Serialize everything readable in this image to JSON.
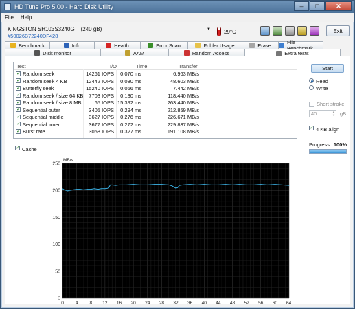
{
  "window": {
    "title": "HD Tune Pro 5.00 - Hard Disk Utility",
    "minimize": "–",
    "maximize": "□",
    "close": "✕"
  },
  "menu": {
    "file": "File",
    "help": "Help"
  },
  "device": {
    "name": "KINGSTON SH103S3240G",
    "capacity": "(240 gB)",
    "serial": "#50026B72240DF428",
    "temperature": "29°C",
    "exit_label": "Exit"
  },
  "tabs_top": [
    {
      "label": "Benchmark",
      "icon": "benchmark-icon",
      "color": "#e8b320"
    },
    {
      "label": "Info",
      "icon": "info-icon",
      "color": "#2d63b8"
    },
    {
      "label": "Health",
      "icon": "health-icon",
      "color": "#d52424"
    },
    {
      "label": "Error Scan",
      "icon": "error-scan-icon",
      "color": "#3a8e2a"
    },
    {
      "label": "Folder Usage",
      "icon": "folder-icon",
      "color": "#e6c24a"
    },
    {
      "label": "Erase",
      "icon": "erase-icon",
      "color": "#a6a6a6"
    },
    {
      "label": "File Benchmark",
      "icon": "file-benchmark-icon",
      "color": "#3f7fd0"
    }
  ],
  "tabs_bottom": [
    {
      "label": "Disk monitor",
      "icon": "disk-monitor-icon",
      "color": "#555555"
    },
    {
      "label": "AAM",
      "icon": "speaker-icon",
      "color": "#c0a030"
    },
    {
      "label": "Random Access",
      "icon": "random-access-icon",
      "color": "#cc3333"
    },
    {
      "label": "Extra tests",
      "icon": "extra-tests-icon",
      "color": "#777777"
    }
  ],
  "table": {
    "headers": {
      "test": "Test",
      "io": "I/O",
      "time": "Time",
      "transfer": "Transfer"
    },
    "rows": [
      {
        "test": "Random seek",
        "io": "14261 IOPS",
        "time": "0.070 ms",
        "transfer": "6.963 MB/s"
      },
      {
        "test": "Random seek 4 KB",
        "io": "12442 IOPS",
        "time": "0.080 ms",
        "transfer": "48.603 MB/s"
      },
      {
        "test": "Butterfly seek",
        "io": "15240 IOPS",
        "time": "0.066 ms",
        "transfer": "7.442 MB/s"
      },
      {
        "test": "Random seek / size 64 KB",
        "io": "7703 IOPS",
        "time": "0.130 ms",
        "transfer": "118.440 MB/s"
      },
      {
        "test": "Random seek / size 8 MB",
        "io": "65 IOPS",
        "time": "15.392 ms",
        "transfer": "263.440 MB/s"
      },
      {
        "test": "Sequential outer",
        "io": "3405 IOPS",
        "time": "0.294 ms",
        "transfer": "212.859 MB/s"
      },
      {
        "test": "Sequential middle",
        "io": "3627 IOPS",
        "time": "0.276 ms",
        "transfer": "226.671 MB/s"
      },
      {
        "test": "Sequential inner",
        "io": "3677 IOPS",
        "time": "0.272 ms",
        "transfer": "229.837 MB/s"
      },
      {
        "test": "Burst rate",
        "io": "3058 IOPS",
        "time": "0.327 ms",
        "transfer": "191.108 MB/s"
      }
    ]
  },
  "cache_label": "Cache",
  "controls": {
    "start": "Start",
    "read": "Read",
    "write": "Write",
    "short_stroke": "Short stroke",
    "short_stroke_value": "40",
    "gb": "gB",
    "align": "4 KB align",
    "progress_label": "Progress:",
    "progress_value": "100%",
    "progress_fraction": 1.0
  },
  "chart_data": {
    "type": "line",
    "ylabel": "MB/s",
    "xlabel": "MB",
    "ylim": [
      0,
      250
    ],
    "xlim": [
      0,
      64
    ],
    "yticks": [
      0,
      50,
      100,
      150,
      200,
      250
    ],
    "xticks": [
      0,
      4,
      8,
      12,
      16,
      20,
      24,
      28,
      32,
      36,
      40,
      44,
      48,
      52,
      56,
      60,
      64
    ],
    "x_last_tick_label": "64MB",
    "series": [
      {
        "color": "#3cb4e8",
        "x": [
          0,
          0.5,
          1,
          1.5,
          2,
          3,
          4,
          5,
          6,
          7,
          8,
          9,
          10,
          11,
          12,
          13,
          13.5,
          14,
          15,
          16,
          18,
          20,
          22,
          24,
          26,
          28,
          30,
          31,
          32,
          32.5,
          33,
          34,
          36,
          38,
          40,
          42,
          44,
          46,
          48,
          50,
          52,
          54,
          56,
          58,
          60,
          62,
          64
        ],
        "y": [
          203,
          201,
          200,
          199,
          200,
          201,
          202,
          202,
          201,
          202,
          202,
          203,
          202,
          203,
          203,
          204,
          210,
          210,
          209,
          210,
          210,
          211,
          210,
          210,
          211,
          211,
          210,
          208,
          204,
          205,
          209,
          210,
          211,
          210,
          211,
          210,
          210,
          211,
          210,
          211,
          210,
          210,
          211,
          210,
          211,
          210,
          209
        ]
      }
    ],
    "grid": true
  }
}
